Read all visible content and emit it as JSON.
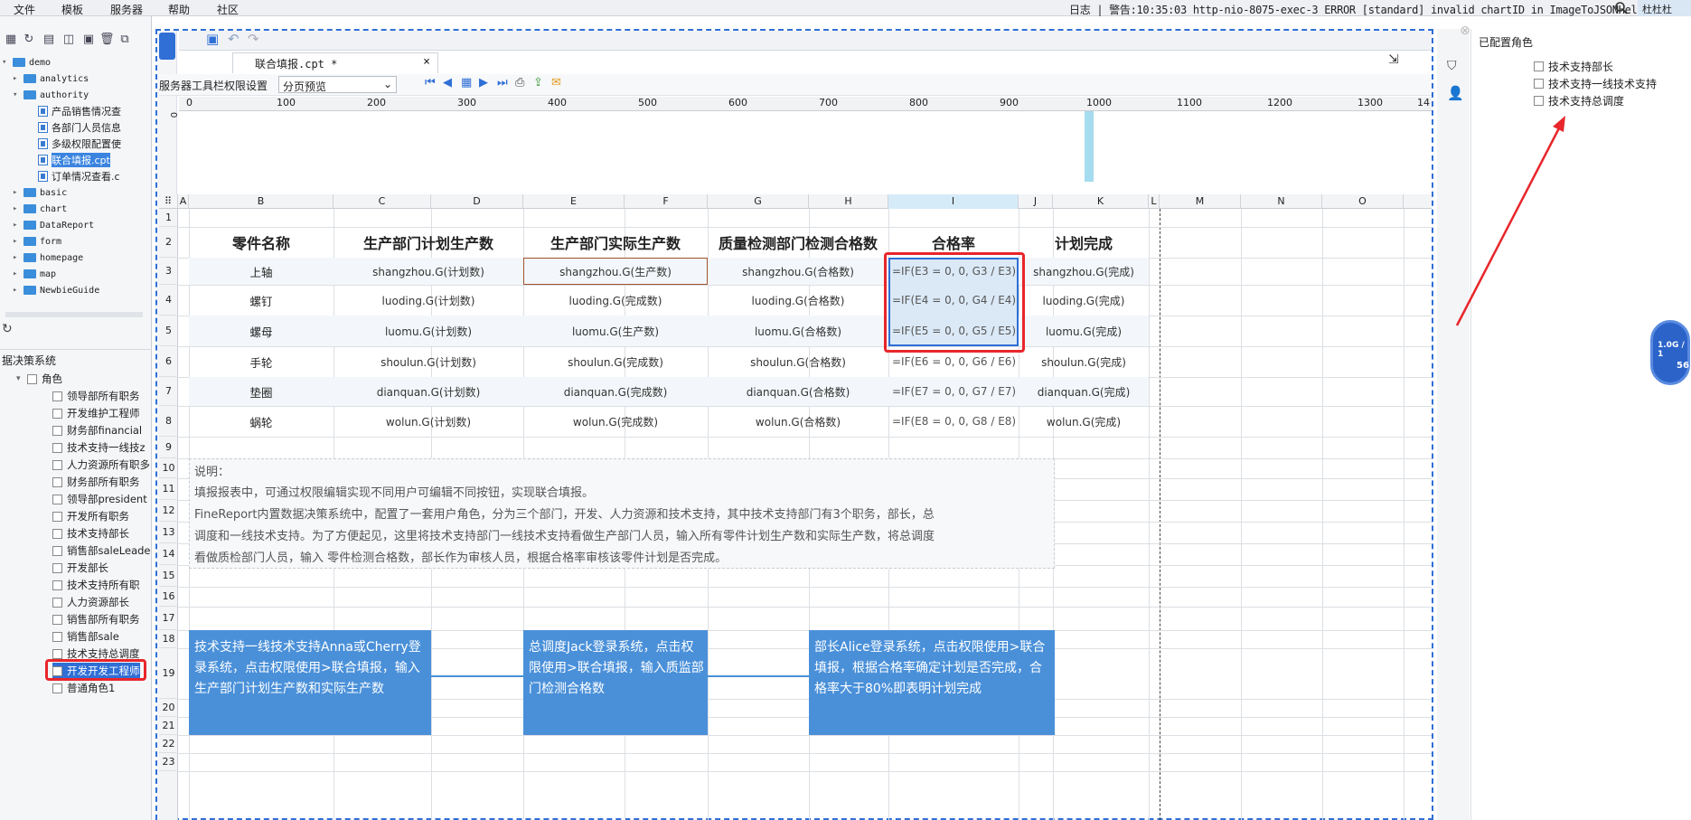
{
  "menu": [
    "文件",
    "模板",
    "服务器",
    "帮助",
    "社区"
  ],
  "log": "日志 | 警告:10:35:03 http-nio-8075-exec-3 ERROR [standard] invalid chartID in ImageToJSONHelper",
  "user": "杜杜杜",
  "tree": {
    "root": "demo",
    "items": [
      {
        "label": "analytics",
        "level": 1,
        "type": "folder",
        "open": false
      },
      {
        "label": "authority",
        "level": 1,
        "type": "folder",
        "open": true
      },
      {
        "label": "产品销售情况查",
        "level": 2,
        "type": "file"
      },
      {
        "label": "各部门人员信息",
        "level": 2,
        "type": "file"
      },
      {
        "label": "多级权限配置使",
        "level": 2,
        "type": "file"
      },
      {
        "label": "联合填报.cpt",
        "level": 2,
        "type": "file",
        "selected": true
      },
      {
        "label": "订单情况查看.c",
        "level": 2,
        "type": "file"
      },
      {
        "label": "basic",
        "level": 1,
        "type": "folder"
      },
      {
        "label": "chart",
        "level": 1,
        "type": "folder"
      },
      {
        "label": "DataReport",
        "level": 1,
        "type": "folder"
      },
      {
        "label": "form",
        "level": 1,
        "type": "folder"
      },
      {
        "label": "homepage",
        "level": 1,
        "type": "folder"
      },
      {
        "label": "map",
        "level": 1,
        "type": "folder"
      },
      {
        "label": "NewbieGuide",
        "level": 1,
        "type": "folder"
      }
    ]
  },
  "permission": {
    "section_title": "据决策系统",
    "group": "角色",
    "roles": [
      "领导部所有职务",
      "开发维护工程师",
      "财务部financial",
      "技术支持一线技z",
      "人力资源所有职多",
      "财务部所有职务",
      "领导部president",
      "开发所有职务",
      "技术支持部长",
      "销售部saleLeade",
      "开发部长",
      "技术支持所有职",
      "人力资源部长",
      "销售部所有职务",
      "销售部sale",
      "技术支持总调度",
      "开发开发工程师",
      "普通角色1"
    ]
  },
  "designer": {
    "tab_title": "联合填报.cpt *",
    "toolbar_label": "服务器工具栏权限设置",
    "preview_select": "分页预览",
    "ruler_ticks": [
      "0",
      "100",
      "200",
      "300",
      "400",
      "500",
      "600",
      "700",
      "800",
      "900",
      "1000",
      "1100",
      "1200",
      "1300",
      "14"
    ],
    "columns": [
      "A",
      "B",
      "C",
      "D",
      "E",
      "F",
      "G",
      "H",
      "I",
      "J",
      "K",
      "L",
      "M",
      "N",
      "O"
    ],
    "rows": [
      "1",
      "2",
      "3",
      "4",
      "5",
      "6",
      "7",
      "8",
      "9",
      "10",
      "11",
      "12",
      "13",
      "14",
      "15",
      "16",
      "17",
      "18",
      "19",
      "20",
      "21",
      "22",
      "23"
    ]
  },
  "sheet": {
    "headers": [
      "零件名称",
      "生产部门计划生产数",
      "生产部门实际生产数",
      "质量检测部门检测合格数",
      "合格率",
      "计划完成"
    ],
    "rows": [
      [
        "上轴",
        "shangzhou.G(计划数)",
        "shangzhou.G(生产数)",
        "shangzhou.G(合格数)",
        "=IF(E3 = 0, 0, G3 / E3)",
        "shangzhou.G(完成)"
      ],
      [
        "螺钉",
        "luoding.G(计划数)",
        "luoding.G(完成数)",
        "luoding.G(合格数)",
        "=IF(E4 = 0, 0, G4 / E4)",
        "luoding.G(完成)"
      ],
      [
        "螺母",
        "luomu.G(计划数)",
        "luomu.G(生产数)",
        "luomu.G(合格数)",
        "=IF(E5 = 0, 0, G5 / E5)",
        "luomu.G(完成)"
      ],
      [
        "手轮",
        "shoulun.G(计划数)",
        "shoulun.G(完成数)",
        "shoulun.G(合格数)",
        "=IF(E6 = 0, 0, G6 / E6)",
        "shoulun.G(完成)"
      ],
      [
        "垫圈",
        "dianquan.G(计划数)",
        "dianquan.G(完成数)",
        "dianquan.G(合格数)",
        "=IF(E7 = 0, 0, G7 / E7)",
        "dianquan.G(完成)"
      ],
      [
        "蜗轮",
        "wolun.G(计划数)",
        "wolun.G(完成数)",
        "wolun.G(合格数)",
        "=IF(E8 = 0, 0, G8 / E8)",
        "wolun.G(完成)"
      ]
    ],
    "note_title": "说明：",
    "note_lines": [
      "填报报表中，可通过权限编辑实现不同用户可编辑不同按钮，实现联合填报。",
      "FineReport内置数据决策系统中，配置了一套用户角色，分为三个部门，开发、人力资源和技术支持，其中技术支持部门有3个职务，部长，总",
      "调度和一线技术支持。为了方便起见，这里将技术支持部门一线技术支持看做生产部门人员，输入所有零件计划生产数和实际生产数，将总调度",
      "看做质检部门人员，输入 零件检测合格数，部长作为审核人员，根据合格率审核该零件计划是否完成。"
    ],
    "flow": [
      "技术支持一线技术支持Anna或Cherry登录系统，点击权限使用>联合填报，输入生产部门计划生产数和实际生产数",
      "总调度Jack登录系统，点击权限使用>联合填报，输入质监部门检测合格数",
      "部长Alice登录系统，点击权限使用>联合填报，根据合格率确定计划是否完成，合格率大于80%即表明计划完成"
    ]
  },
  "right_panel": {
    "title": "已配置角色",
    "roles": [
      "技术支持部长",
      "技术支持一线技术支持",
      "技术支持总调度"
    ]
  },
  "memory": {
    "line1": "1.0G / 1",
    "line2": "56"
  }
}
